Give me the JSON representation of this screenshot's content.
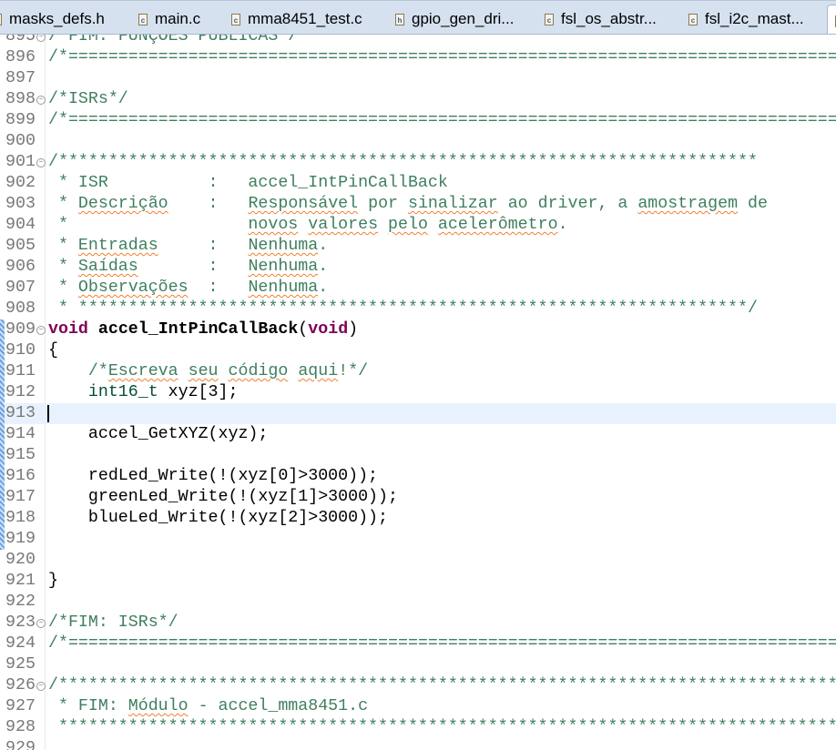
{
  "tabs": [
    {
      "label": "masks_defs.h",
      "icon": "h-file-icon",
      "glyph": "h"
    },
    {
      "label": "main.c",
      "icon": "c-file-icon",
      "glyph": "c"
    },
    {
      "label": "mma8451_test.c",
      "icon": "c-file-icon",
      "glyph": "c"
    },
    {
      "label": "gpio_gen_dri...",
      "icon": "h-file-icon",
      "glyph": "h"
    },
    {
      "label": "fsl_os_abstr...",
      "icon": "c-file-icon",
      "glyph": "c"
    },
    {
      "label": "fsl_i2c_mast...",
      "icon": "c-file-icon",
      "glyph": "c"
    },
    {
      "label": "",
      "icon": "c-file-icon",
      "glyph": "c",
      "active": true
    }
  ],
  "colors": {
    "comment": "#3f7f5f",
    "keyword": "#7f0055",
    "type": "#005032",
    "line_number": "#787878",
    "current_line": "#e8f2fe"
  },
  "cursor_line": 913,
  "lines": [
    {
      "n": "895",
      "fold": true,
      "segs": [
        [
          "/*FIM: FUNÇÕES PÚBLICAS*/",
          "cm"
        ]
      ]
    },
    {
      "n": "896",
      "segs": [
        [
          "/*========================================================================================",
          "cm"
        ]
      ]
    },
    {
      "n": "897",
      "segs": []
    },
    {
      "n": "898",
      "fold": true,
      "segs": [
        [
          "/*ISRs*/",
          "cm"
        ]
      ]
    },
    {
      "n": "899",
      "segs": [
        [
          "/*========================================================================================",
          "cm"
        ]
      ]
    },
    {
      "n": "900",
      "segs": []
    },
    {
      "n": "901",
      "fold": true,
      "segs": [
        [
          "/**********************************************************************",
          "cm"
        ]
      ]
    },
    {
      "n": "902",
      "segs": [
        [
          " * ISR          :   accel_IntPinCallBack",
          "cm"
        ]
      ]
    },
    {
      "n": "903",
      "segs": [
        [
          " * ",
          "cm"
        ],
        [
          "Descrição",
          "sp"
        ],
        [
          "    :   ",
          "cm"
        ],
        [
          "Responsável",
          "sp"
        ],
        [
          " por ",
          "cm"
        ],
        [
          "sinalizar",
          "sp"
        ],
        [
          " ao driver, a ",
          "cm"
        ],
        [
          "amostragem",
          "sp"
        ],
        [
          " de",
          "cm"
        ]
      ]
    },
    {
      "n": "904",
      "segs": [
        [
          " *                  ",
          "cm"
        ],
        [
          "novos",
          "sp"
        ],
        [
          " ",
          "cm"
        ],
        [
          "valores",
          "sp"
        ],
        [
          " ",
          "cm"
        ],
        [
          "pelo",
          "sp"
        ],
        [
          " ",
          "cm"
        ],
        [
          "acelerômetro",
          "sp"
        ],
        [
          ".",
          "cm"
        ]
      ]
    },
    {
      "n": "905",
      "segs": [
        [
          " * ",
          "cm"
        ],
        [
          "Entradas",
          "sp"
        ],
        [
          "     :   ",
          "cm"
        ],
        [
          "Nenhuma",
          "sp"
        ],
        [
          ".",
          "cm"
        ]
      ]
    },
    {
      "n": "906",
      "segs": [
        [
          " * ",
          "cm"
        ],
        [
          "Saídas",
          "sp"
        ],
        [
          "       :   ",
          "cm"
        ],
        [
          "Nenhuma",
          "sp"
        ],
        [
          ".",
          "cm"
        ]
      ]
    },
    {
      "n": "907",
      "segs": [
        [
          " * ",
          "cm"
        ],
        [
          "Observações",
          "sp"
        ],
        [
          "  :   ",
          "cm"
        ],
        [
          "Nenhuma",
          "sp"
        ],
        [
          ".",
          "cm"
        ]
      ]
    },
    {
      "n": "908",
      "segs": [
        [
          " * *******************************************************************/",
          "cm"
        ]
      ]
    },
    {
      "n": "909",
      "fold": true,
      "chg": true,
      "segs": [
        [
          "void",
          "kw"
        ],
        [
          " ",
          "tx"
        ],
        [
          "accel_IntPinCallBack",
          "fn"
        ],
        [
          "(",
          "tx"
        ],
        [
          "void",
          "kw"
        ],
        [
          ")",
          "tx"
        ]
      ]
    },
    {
      "n": "910",
      "chg": true,
      "segs": [
        [
          "{",
          "tx"
        ]
      ]
    },
    {
      "n": "911",
      "chg": true,
      "segs": [
        [
          "    /*",
          "cm"
        ],
        [
          "Escreva",
          "sp"
        ],
        [
          " ",
          "cm"
        ],
        [
          "seu",
          "sp"
        ],
        [
          " ",
          "cm"
        ],
        [
          "código",
          "sp"
        ],
        [
          " ",
          "cm"
        ],
        [
          "aqui",
          "sp"
        ],
        [
          "!*/",
          "cm"
        ]
      ]
    },
    {
      "n": "912",
      "chg": true,
      "segs": [
        [
          "    ",
          "tx"
        ],
        [
          "int16_t",
          "ty"
        ],
        [
          " xyz[3];",
          "tx"
        ]
      ]
    },
    {
      "n": "913",
      "chg": true,
      "segs": []
    },
    {
      "n": "914",
      "chg": true,
      "segs": [
        [
          "    accel_GetXYZ(xyz);",
          "tx"
        ]
      ]
    },
    {
      "n": "915",
      "chg": true,
      "segs": []
    },
    {
      "n": "916",
      "chg": true,
      "segs": [
        [
          "    redLed_Write(!(xyz[0]>3000));",
          "tx"
        ]
      ]
    },
    {
      "n": "917",
      "chg": true,
      "segs": [
        [
          "    greenLed_Write(!(xyz[1]>3000));",
          "tx"
        ]
      ]
    },
    {
      "n": "918",
      "chg": true,
      "segs": [
        [
          "    blueLed_Write(!(xyz[2]>3000));",
          "tx"
        ]
      ]
    },
    {
      "n": "919",
      "chg": true,
      "segs": []
    },
    {
      "n": "920",
      "segs": []
    },
    {
      "n": "921",
      "segs": [
        [
          "}",
          "tx"
        ]
      ]
    },
    {
      "n": "922",
      "segs": []
    },
    {
      "n": "923",
      "fold": true,
      "segs": [
        [
          "/*FIM: ISRs*/",
          "cm"
        ]
      ]
    },
    {
      "n": "924",
      "segs": [
        [
          "/*========================================================================================",
          "cm"
        ]
      ]
    },
    {
      "n": "925",
      "segs": []
    },
    {
      "n": "926",
      "fold": true,
      "segs": [
        [
          "/*******************************************************************************************",
          "cm"
        ]
      ]
    },
    {
      "n": "927",
      "segs": [
        [
          " * FIM: ",
          "cm"
        ],
        [
          "Módulo",
          "sp"
        ],
        [
          " - accel_mma8451.c",
          "cm"
        ]
      ]
    },
    {
      "n": "928",
      "segs": [
        [
          " ******************************************************************************************",
          "cm"
        ]
      ]
    },
    {
      "n": "929",
      "segs": []
    }
  ]
}
